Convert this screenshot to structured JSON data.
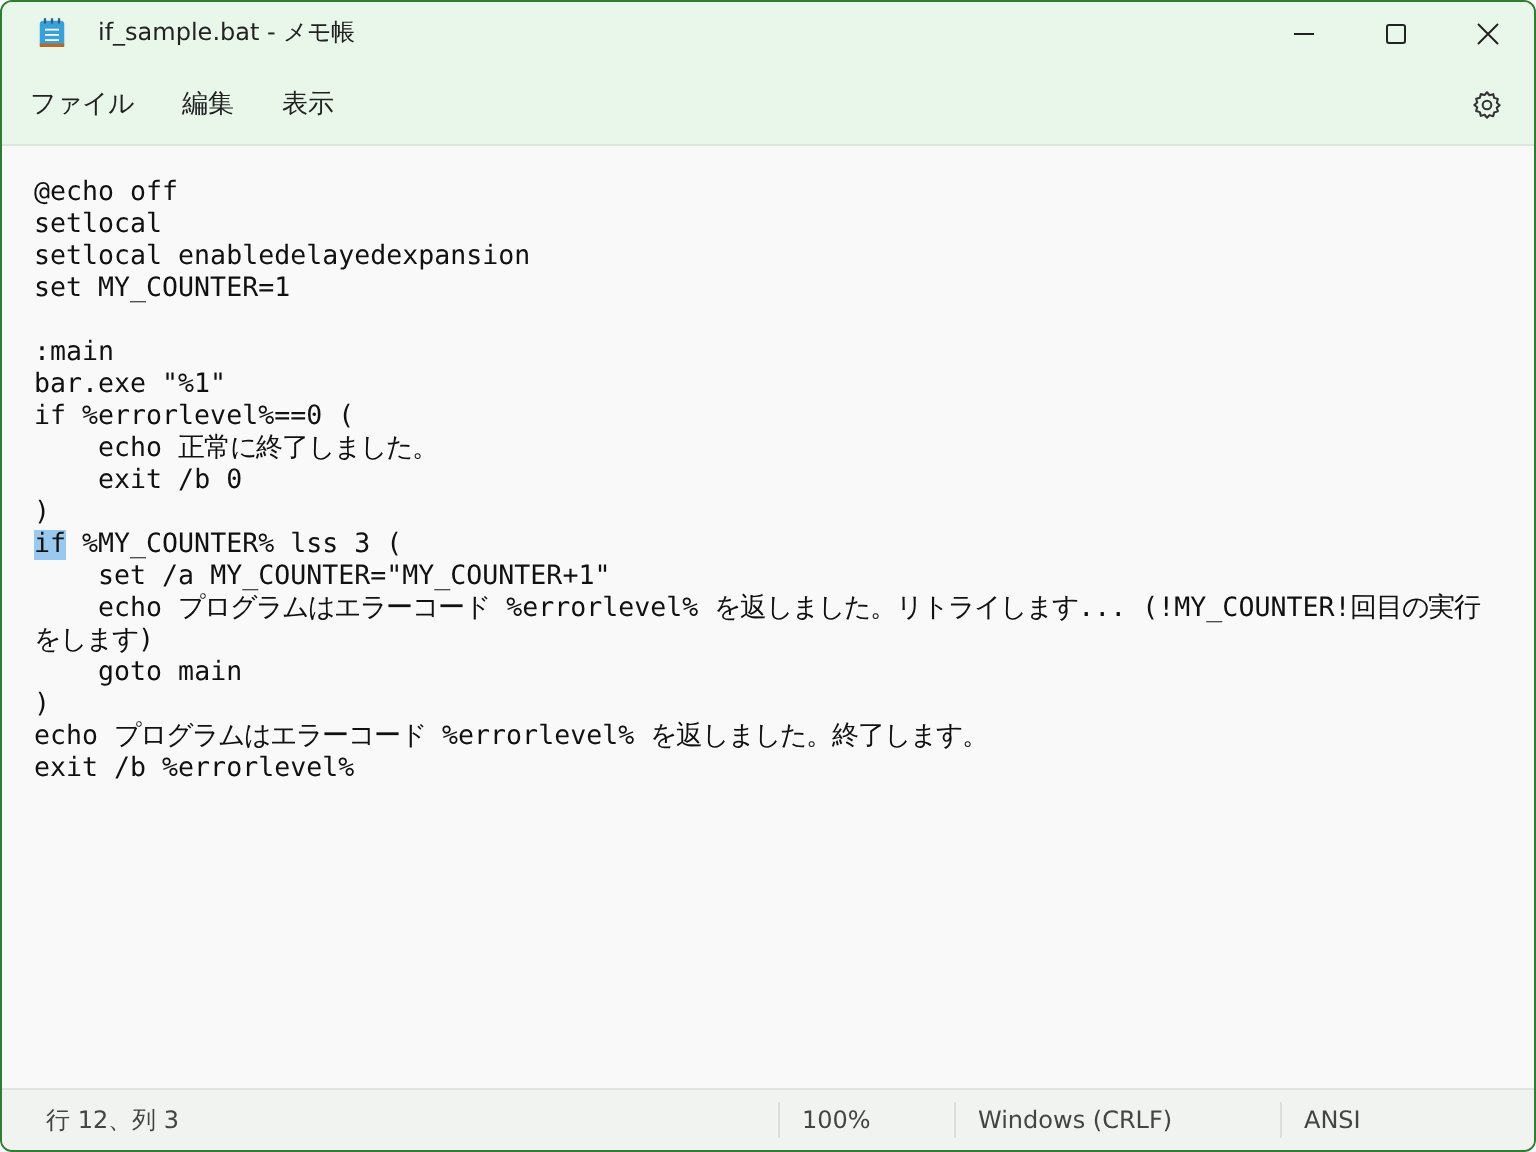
{
  "window": {
    "title": "if_sample.bat - メモ帳"
  },
  "menu": [
    "ファイル",
    "編集",
    "表示"
  ],
  "editor": {
    "lines": [
      {
        "kind": "code",
        "segments": [
          {
            "text": "@echo off",
            "selected": false
          }
        ]
      },
      {
        "kind": "code",
        "segments": [
          {
            "text": "setlocal",
            "selected": false
          }
        ]
      },
      {
        "kind": "code",
        "segments": [
          {
            "text": "setlocal enabledelayedexpansion",
            "selected": false
          }
        ]
      },
      {
        "kind": "code",
        "segments": [
          {
            "text": "set MY_COUNTER=1",
            "selected": false
          }
        ]
      },
      {
        "kind": "blank"
      },
      {
        "kind": "code",
        "segments": [
          {
            "text": ":main",
            "selected": false
          }
        ]
      },
      {
        "kind": "code",
        "segments": [
          {
            "text": "bar.exe \"%1\"",
            "selected": false
          }
        ]
      },
      {
        "kind": "code",
        "segments": [
          {
            "text": "if %errorlevel%==0 (",
            "selected": false
          }
        ]
      },
      {
        "kind": "code",
        "segments": [
          {
            "text": "    echo 正常に終了しました。",
            "selected": false
          }
        ]
      },
      {
        "kind": "code",
        "segments": [
          {
            "text": "    exit /b 0",
            "selected": false
          }
        ]
      },
      {
        "kind": "code",
        "segments": [
          {
            "text": ")",
            "selected": false
          }
        ]
      },
      {
        "kind": "code",
        "segments": [
          {
            "text": "if",
            "selected": true
          },
          {
            "text": " %MY_COUNTER% lss 3 (",
            "selected": false
          }
        ]
      },
      {
        "kind": "code",
        "segments": [
          {
            "text": "    set /a MY_COUNTER=\"MY_COUNTER+1\"",
            "selected": false
          }
        ]
      },
      {
        "kind": "code",
        "segments": [
          {
            "text": "    echo プログラムはエラーコード %errorlevel% を返しました。リトライします... (!MY_COUNTER!回目の実行をします)",
            "selected": false
          }
        ]
      },
      {
        "kind": "code",
        "segments": [
          {
            "text": "    goto main",
            "selected": false
          }
        ]
      },
      {
        "kind": "code",
        "segments": [
          {
            "text": ")",
            "selected": false
          }
        ]
      },
      {
        "kind": "code",
        "segments": [
          {
            "text": "echo プログラムはエラーコード %errorlevel% を返しました。終了します。",
            "selected": false
          }
        ]
      },
      {
        "kind": "code",
        "segments": [
          {
            "text": "exit /b %errorlevel%",
            "selected": false
          }
        ]
      }
    ]
  },
  "status_bar": {
    "position": "行 12、列 3",
    "zoom": "100%",
    "line_ending": "Windows (CRLF)",
    "encoding": "ANSI"
  }
}
